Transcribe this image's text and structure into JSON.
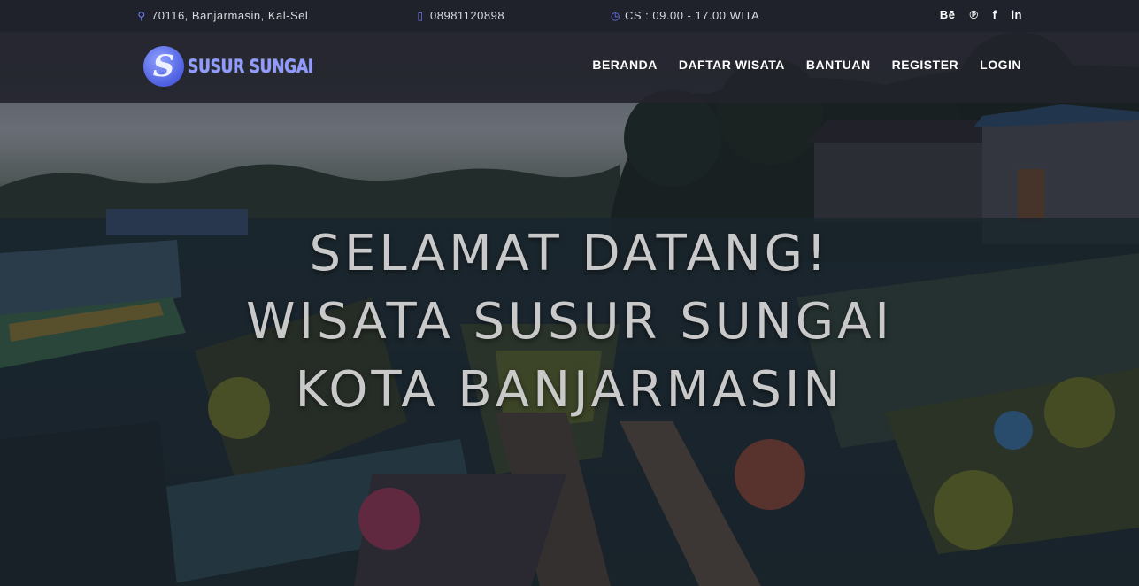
{
  "topbar": {
    "address": "70116, Banjarmasin, Kal-Sel",
    "phone": "08981120898",
    "hours": "CS : 09.00 - 17.00 WITA",
    "social": [
      {
        "label": "Bē",
        "icon": "behance-icon"
      },
      {
        "label": "℗",
        "icon": "pinterest-icon"
      },
      {
        "label": "f",
        "icon": "facebook-icon"
      },
      {
        "label": "in",
        "icon": "linkedin-icon"
      }
    ]
  },
  "nav": {
    "logo_letter": "S",
    "logo_text": "SUSUR SUNGAI",
    "menu": [
      "BERANDA",
      "DAFTAR WISATA",
      "BANTUAN",
      "REGISTER",
      "LOGIN"
    ]
  },
  "hero": {
    "line1": "SELAMAT DATANG!",
    "line2": "WISATA SUSUR SUNGAI",
    "line3": "KOTA BANJARMASIN"
  },
  "colors": {
    "topbar_bg": "#1f222b",
    "nav_bg": "#22242c",
    "accent": "#6f7bff",
    "headline": "#c9c9c9"
  }
}
